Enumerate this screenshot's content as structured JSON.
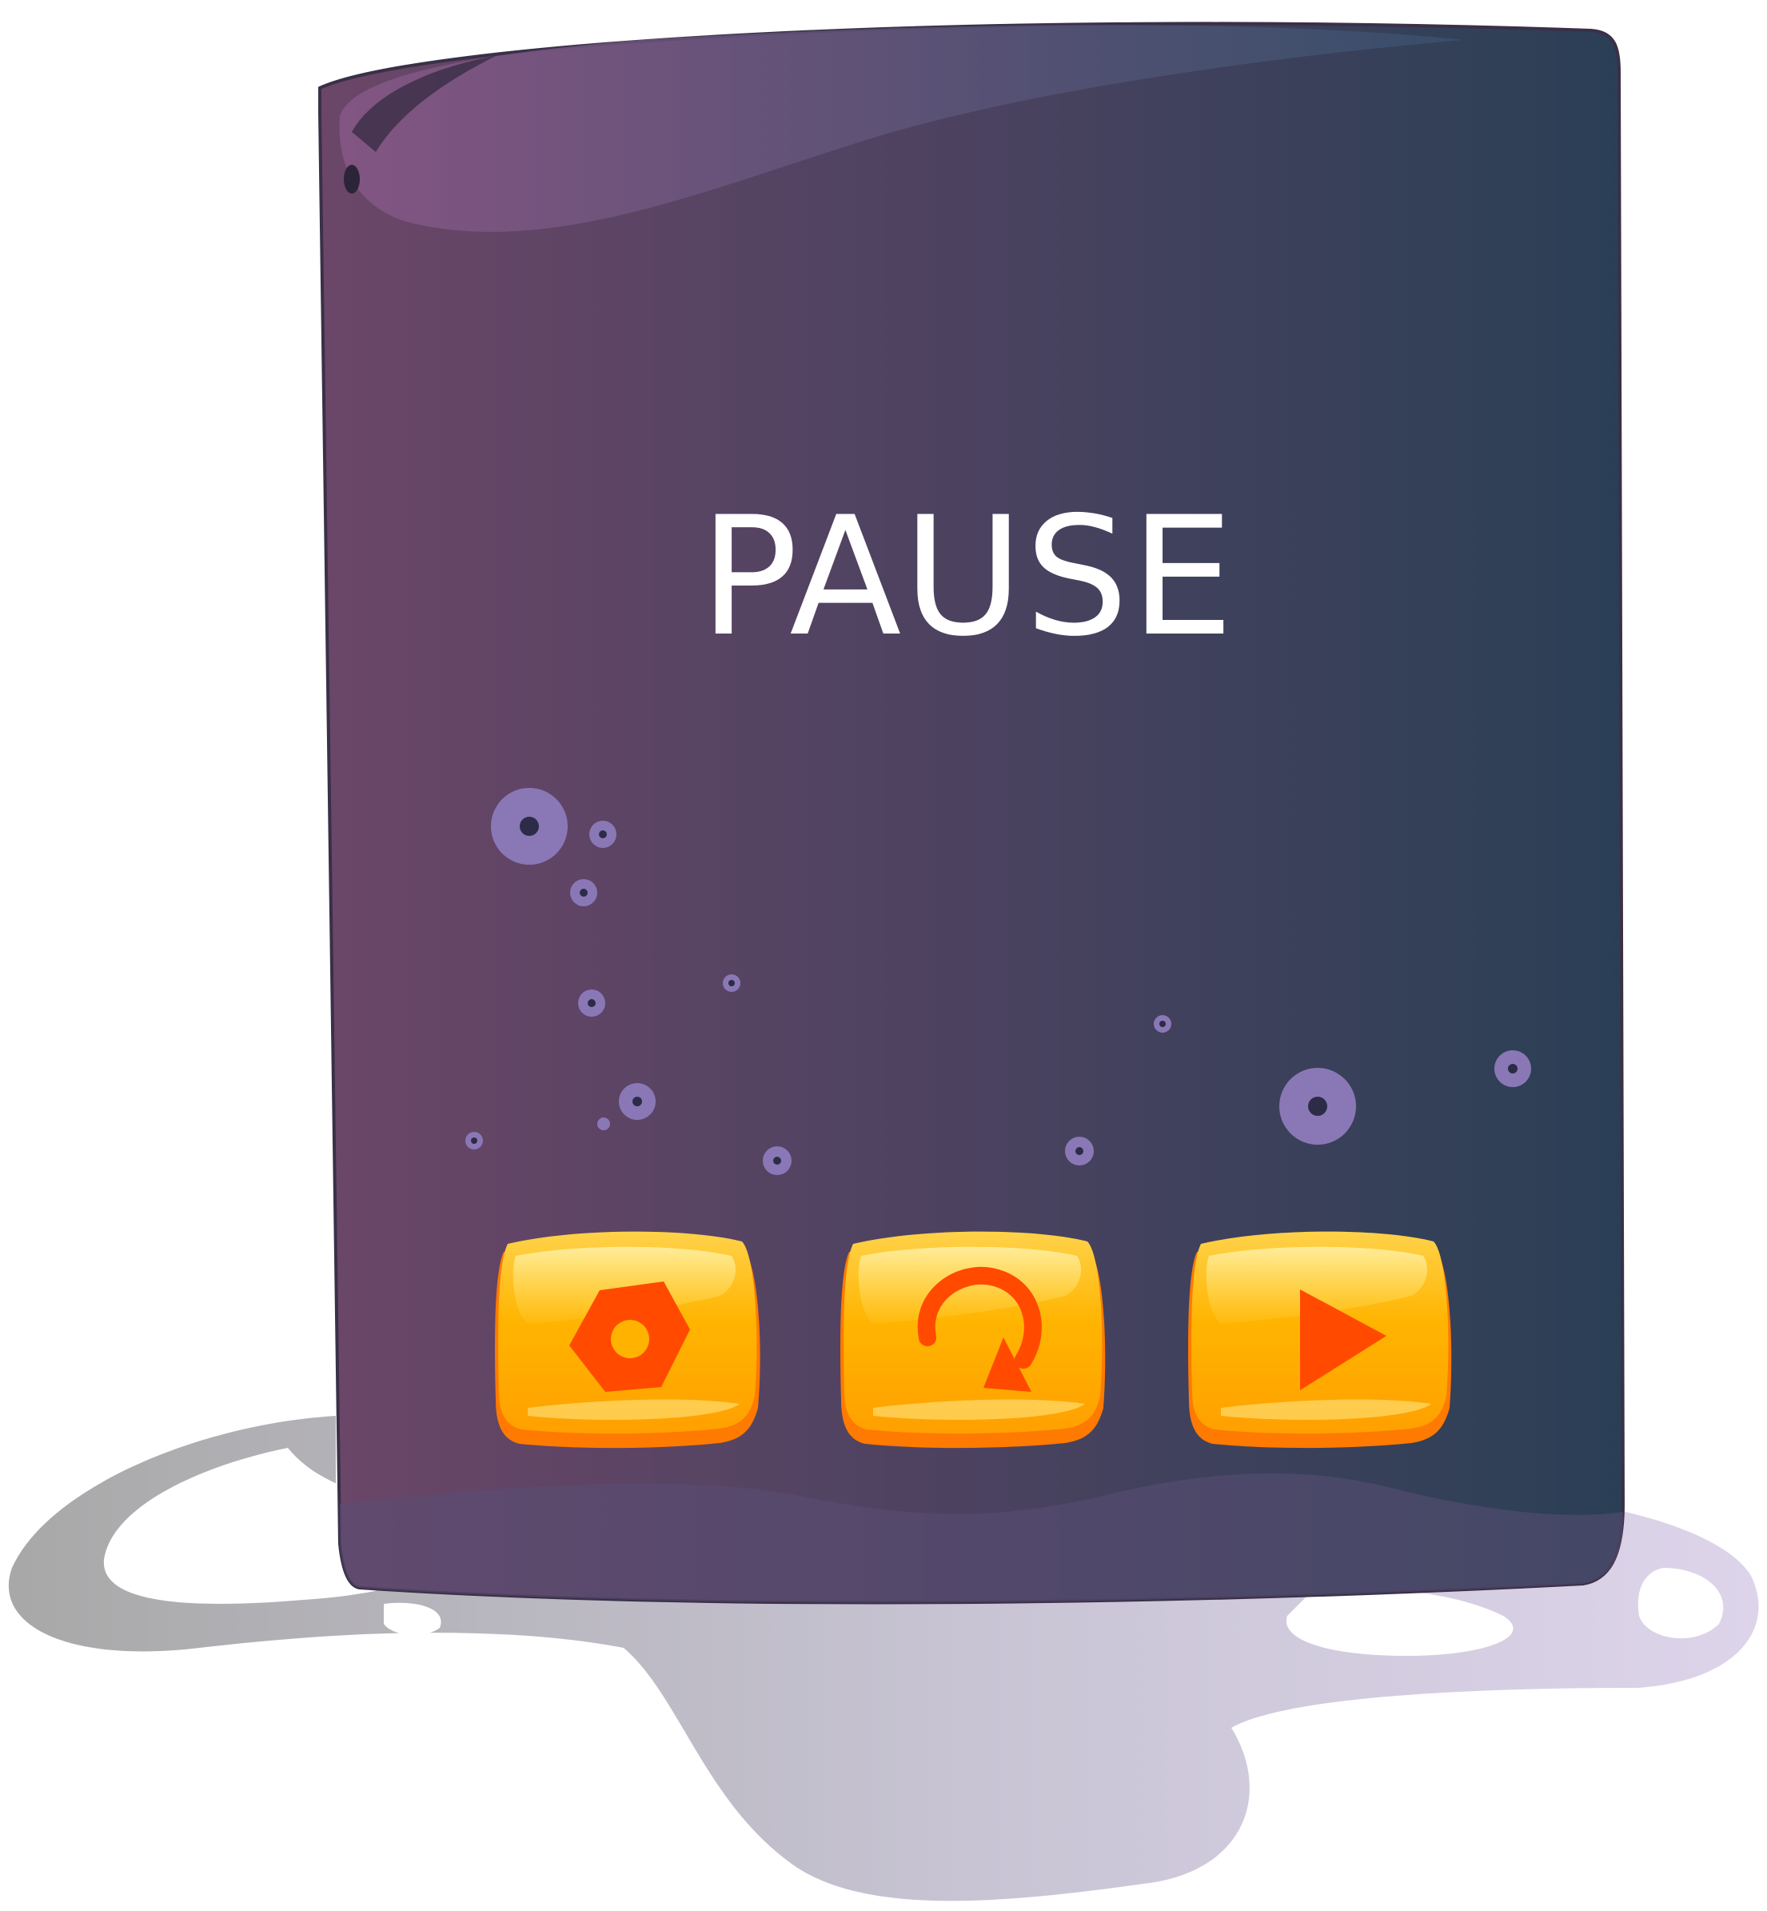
{
  "screen": {
    "title": "PAUSE"
  },
  "buttons": [
    {
      "icon": "gear-icon",
      "action": "settings"
    },
    {
      "icon": "restart-icon",
      "action": "restart"
    },
    {
      "icon": "play-icon",
      "action": "resume"
    }
  ],
  "colors": {
    "panel_left": "#6b4668",
    "panel_right": "#2a3f55",
    "button_yellow": "#ffb300",
    "button_orange": "#ff5a00",
    "title_text": "#ffffff",
    "bubble": "#8a78b6"
  }
}
